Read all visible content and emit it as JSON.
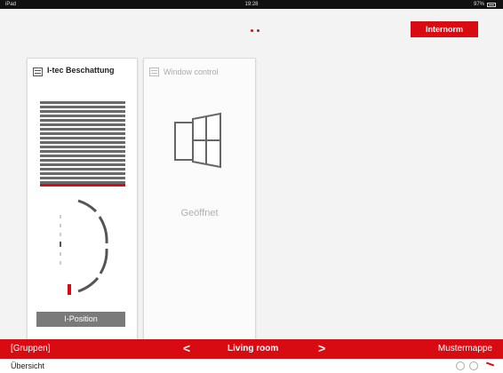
{
  "status_bar": {
    "device": "iPad",
    "time": "19:28",
    "battery": "97%"
  },
  "header": {
    "brand": "Internorm",
    "page_count": 2
  },
  "cards": [
    {
      "title": "I-tec Beschattung",
      "icon": "blind-icon",
      "position_button": "I-Position"
    },
    {
      "title": "Window control",
      "icon": "window-icon",
      "status": "Geöffnet"
    }
  ],
  "nav": {
    "groups": "[Gruppen]",
    "prev": "<",
    "room": "Living room",
    "next": ">",
    "right": "Mustermappe"
  },
  "bottom": {
    "overview": "Übersicht"
  },
  "colors": {
    "accent": "#d90b12",
    "slat": "#6a6a6a",
    "background": "#f3f3f3"
  }
}
